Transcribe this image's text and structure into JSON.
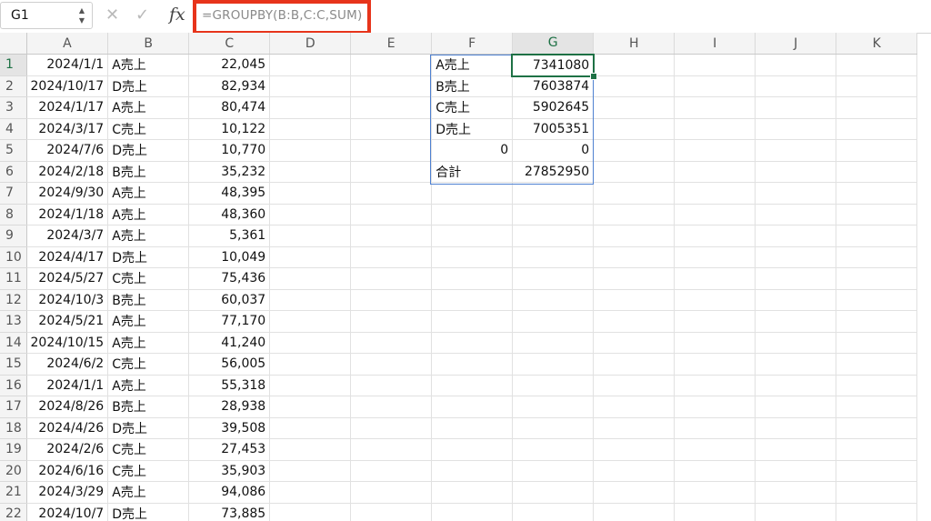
{
  "formula_bar": {
    "cell_ref": "G1",
    "stepper_up": "▲",
    "stepper_down": "▼",
    "cancel_glyph": "✕",
    "confirm_glyph": "✓",
    "fx_label": "fx",
    "formula": "=GROUPBY(B:B,C:C,SUM)"
  },
  "sheet": {
    "columns": [
      "A",
      "B",
      "C",
      "D",
      "E",
      "F",
      "G",
      "H",
      "I",
      "J",
      "K"
    ],
    "selected_column": "G",
    "selected_row": 1,
    "rows": [
      {
        "num": "1",
        "A": "2024/1/1",
        "B": "A売上",
        "C": "22,045",
        "F": "A売上",
        "G": "7341080"
      },
      {
        "num": "2",
        "A": "2024/10/17",
        "B": "D売上",
        "C": "82,934",
        "F": "B売上",
        "G": "7603874"
      },
      {
        "num": "3",
        "A": "2024/1/17",
        "B": "A売上",
        "C": "80,474",
        "F": "C売上",
        "G": "5902645"
      },
      {
        "num": "4",
        "A": "2024/3/17",
        "B": "C売上",
        "C": "10,122",
        "F": "D売上",
        "G": "7005351"
      },
      {
        "num": "5",
        "A": "2024/7/6",
        "B": "D売上",
        "C": "10,770",
        "F": "0",
        "G": "0"
      },
      {
        "num": "6",
        "A": "2024/2/18",
        "B": "B売上",
        "C": "35,232",
        "F": "合計",
        "G": "27852950"
      },
      {
        "num": "7",
        "A": "2024/9/30",
        "B": "A売上",
        "C": "48,395",
        "F": "",
        "G": ""
      },
      {
        "num": "8",
        "A": "2024/1/18",
        "B": "A売上",
        "C": "48,360",
        "F": "",
        "G": ""
      },
      {
        "num": "9",
        "A": "2024/3/7",
        "B": "A売上",
        "C": "5,361",
        "F": "",
        "G": ""
      },
      {
        "num": "10",
        "A": "2024/4/17",
        "B": "D売上",
        "C": "10,049",
        "F": "",
        "G": ""
      },
      {
        "num": "11",
        "A": "2024/5/27",
        "B": "C売上",
        "C": "75,436",
        "F": "",
        "G": ""
      },
      {
        "num": "12",
        "A": "2024/10/3",
        "B": "B売上",
        "C": "60,037",
        "F": "",
        "G": ""
      },
      {
        "num": "13",
        "A": "2024/5/21",
        "B": "A売上",
        "C": "77,170",
        "F": "",
        "G": ""
      },
      {
        "num": "14",
        "A": "2024/10/15",
        "B": "A売上",
        "C": "41,240",
        "F": "",
        "G": ""
      },
      {
        "num": "15",
        "A": "2024/6/2",
        "B": "C売上",
        "C": "56,005",
        "F": "",
        "G": ""
      },
      {
        "num": "16",
        "A": "2024/1/1",
        "B": "A売上",
        "C": "55,318",
        "F": "",
        "G": ""
      },
      {
        "num": "17",
        "A": "2024/8/26",
        "B": "B売上",
        "C": "28,938",
        "F": "",
        "G": ""
      },
      {
        "num": "18",
        "A": "2024/4/26",
        "B": "D売上",
        "C": "39,508",
        "F": "",
        "G": ""
      },
      {
        "num": "19",
        "A": "2024/2/6",
        "B": "C売上",
        "C": "27,453",
        "F": "",
        "G": ""
      },
      {
        "num": "20",
        "A": "2024/6/16",
        "B": "C売上",
        "C": "35,903",
        "F": "",
        "G": ""
      },
      {
        "num": "21",
        "A": "2024/3/29",
        "B": "A売上",
        "C": "94,086",
        "F": "",
        "G": ""
      },
      {
        "num": "22",
        "A": "2024/10/7",
        "B": "D売上",
        "C": "73,885",
        "F": "",
        "G": ""
      }
    ]
  },
  "colors": {
    "selection_green": "#1e7145",
    "spill_blue": "#4f81d1",
    "highlight_red": "#e7341b"
  }
}
